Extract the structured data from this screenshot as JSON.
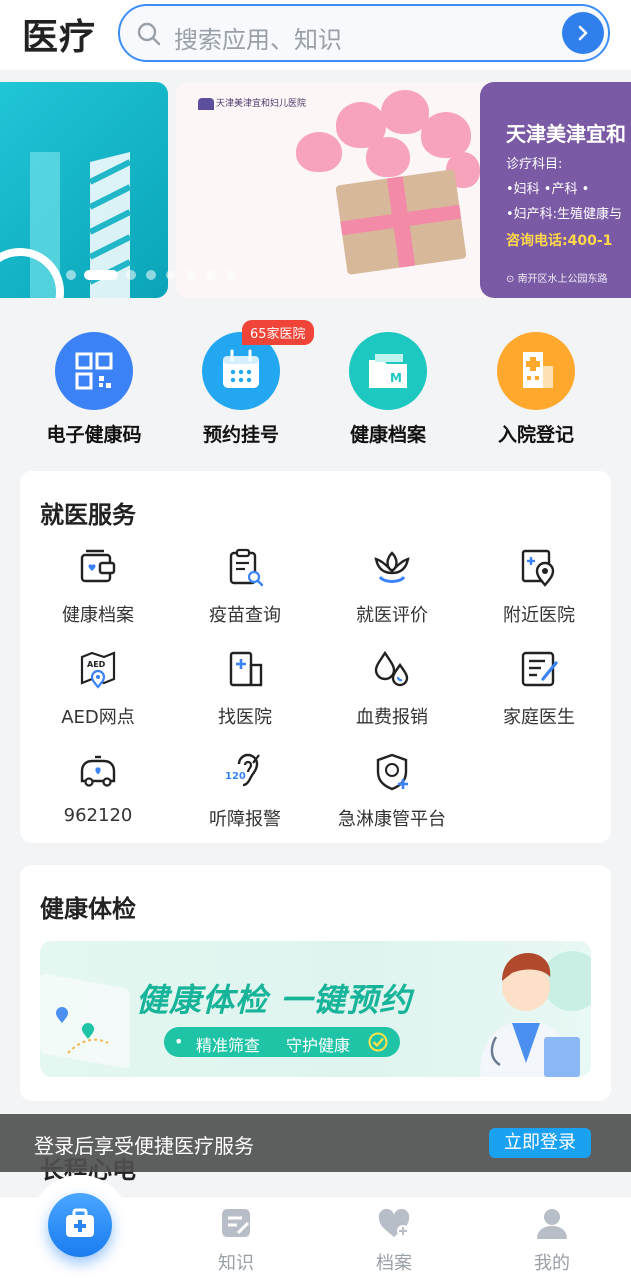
{
  "header": {
    "title": "医疗",
    "search_placeholder": "搜索应用、知识"
  },
  "banner": {
    "hospital_logo_text": "天津美津宜和妇儿医院",
    "card_heading": "天津美津宜和",
    "line1": "诊疗科目:",
    "line2": "•妇科   •产科   •",
    "line3": "•妇产科:生殖健康与",
    "phone": "咨询电话:400-1",
    "address": "南开区水上公园东路",
    "dots_count": 8,
    "active_dot": 1
  },
  "quick": {
    "badge": "65家医院",
    "items": [
      {
        "label": "电子健康码",
        "icon": "qr-code-icon",
        "color": "#3b82f6"
      },
      {
        "label": "预约挂号",
        "icon": "calendar-icon",
        "color": "#22a7f0"
      },
      {
        "label": "健康档案",
        "icon": "folder-icon",
        "color": "#1cc8c0"
      },
      {
        "label": "入院登记",
        "icon": "hospital-building-icon",
        "color": "#ffa82e"
      }
    ]
  },
  "services": {
    "title": "就医服务",
    "items": [
      {
        "label": "健康档案",
        "icon": "health-record-icon"
      },
      {
        "label": "疫苗查询",
        "icon": "vaccine-search-icon"
      },
      {
        "label": "就医评价",
        "icon": "lotus-icon"
      },
      {
        "label": "附近医院",
        "icon": "nearby-hospital-icon"
      },
      {
        "label": "AED网点",
        "icon": "aed-map-icon"
      },
      {
        "label": "找医院",
        "icon": "find-hospital-icon"
      },
      {
        "label": "血费报销",
        "icon": "blood-drop-icon"
      },
      {
        "label": "家庭医生",
        "icon": "family-doctor-icon"
      },
      {
        "label": "962120",
        "icon": "ambulance-icon"
      },
      {
        "label": "听障报警",
        "icon": "hearing-alarm-icon"
      },
      {
        "label": "急淋康管平台",
        "icon": "shield-care-icon"
      }
    ]
  },
  "exam": {
    "title": "健康体检",
    "banner_text": "健康体检 一键预约",
    "pill_left": "精准筛查",
    "pill_right": "守护健康"
  },
  "toast": {
    "message": "登录后享受便捷医疗服务",
    "button": "立即登录"
  },
  "partial_section_title": "长程心电",
  "nav": {
    "items": [
      {
        "label": "知识",
        "icon": "knowledge-icon"
      },
      {
        "label": "档案",
        "icon": "archive-heart-icon"
      },
      {
        "label": "我的",
        "icon": "profile-icon"
      }
    ]
  },
  "colors": {
    "accent": "#2f80ed",
    "badge": "#f04438",
    "teal": "#18b49a",
    "toast_button": "#1ba1f2"
  }
}
